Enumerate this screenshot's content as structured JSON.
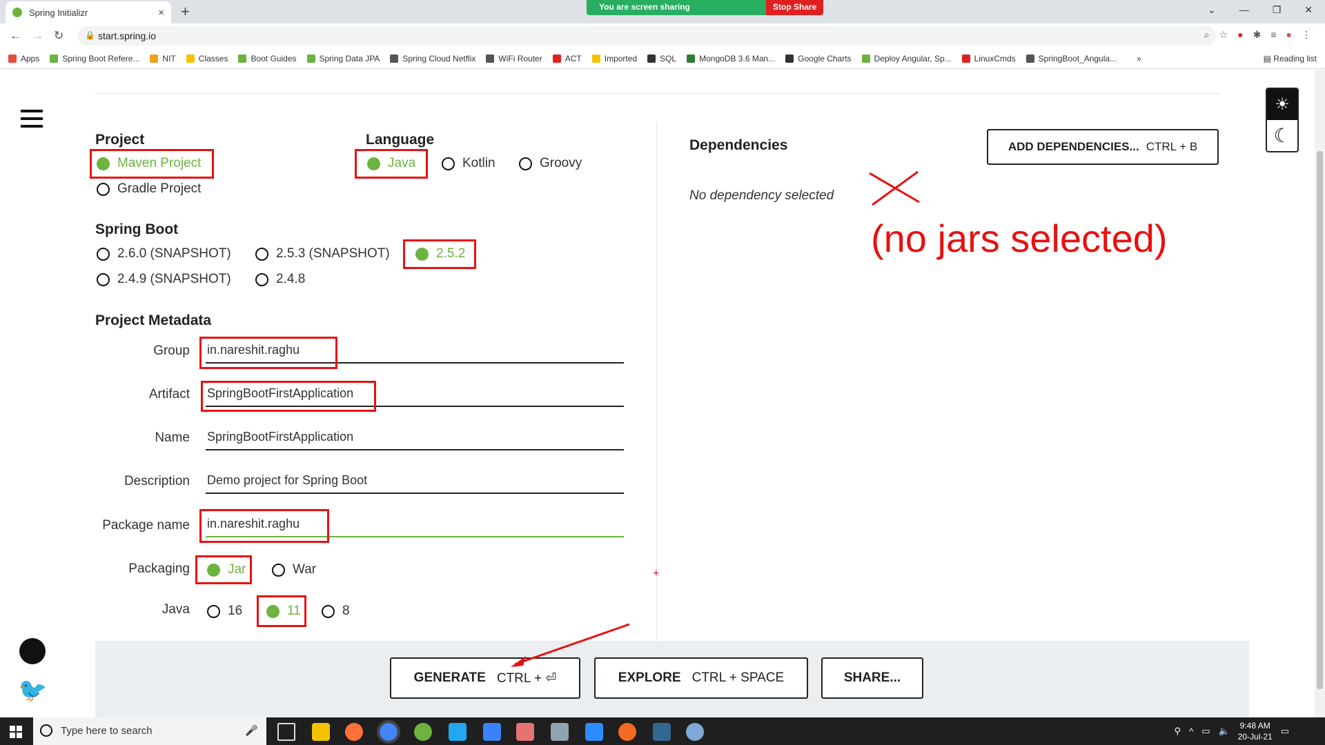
{
  "browser": {
    "tab_title": "Spring Initializr",
    "tab_close": "×",
    "new_tab": "+",
    "url": "start.spring.io",
    "screen_share": {
      "status": "You are screen sharing",
      "stop_label": "Stop Share"
    },
    "bookmarks": [
      {
        "label": "Apps",
        "color": "#e84a3c"
      },
      {
        "label": "Spring Boot Refere...",
        "color": "#6db33f"
      },
      {
        "label": "NIT",
        "color": "#f0a020"
      },
      {
        "label": "Classes",
        "color": "#f3c300"
      },
      {
        "label": "Boot Guides",
        "color": "#6db33f"
      },
      {
        "label": "Spring Data JPA",
        "color": "#6db33f"
      },
      {
        "label": "Spring Cloud Netflix",
        "color": "#555555"
      },
      {
        "label": "WiFi Router",
        "color": "#555555"
      },
      {
        "label": "ACT",
        "color": "#e02020"
      },
      {
        "label": "Imported",
        "color": "#f3c300"
      },
      {
        "label": "SQL",
        "color": "#333333"
      },
      {
        "label": "MongoDB 3.6 Man...",
        "color": "#2e7d32"
      },
      {
        "label": "Google Charts",
        "color": "#333333"
      },
      {
        "label": "Deploy Angular, Sp...",
        "color": "#6db33f"
      },
      {
        "label": "LinuxCmds",
        "color": "#e02020"
      },
      {
        "label": "SpringBoot_Angula...",
        "color": "#555555"
      }
    ],
    "bookmarks_more": "»",
    "reading_list": "Reading list"
  },
  "project": {
    "title": "Project",
    "options": [
      "Maven Project",
      "Gradle Project"
    ],
    "selected": "Maven Project"
  },
  "language": {
    "title": "Language",
    "options": [
      "Java",
      "Kotlin",
      "Groovy"
    ],
    "selected": "Java"
  },
  "spring_boot": {
    "title": "Spring Boot",
    "options": [
      "2.6.0 (SNAPSHOT)",
      "2.5.3 (SNAPSHOT)",
      "2.5.2",
      "2.4.9 (SNAPSHOT)",
      "2.4.8"
    ],
    "selected": "2.5.2"
  },
  "metadata": {
    "title": "Project Metadata",
    "group_label": "Group",
    "group_value": "in.nareshit.raghu",
    "artifact_label": "Artifact",
    "artifact_value": "SpringBootFirstApplication",
    "name_label": "Name",
    "name_value": "SpringBootFirstApplication",
    "description_label": "Description",
    "description_value": "Demo project for Spring Boot",
    "package_label": "Package name",
    "package_value": "in.nareshit.raghu",
    "packaging_label": "Packaging",
    "packaging_options": [
      "Jar",
      "War"
    ],
    "packaging_selected": "Jar",
    "java_label": "Java",
    "java_options": [
      "16",
      "11",
      "8"
    ],
    "java_selected": "11"
  },
  "dependencies": {
    "title": "Dependencies",
    "add_button_label": "ADD DEPENDENCIES...",
    "add_button_shortcut": "CTRL + B",
    "empty_text": "No dependency selected"
  },
  "annotation": {
    "text": "(no jars selected)",
    "color": "#e81010"
  },
  "actions": {
    "generate_label": "GENERATE",
    "generate_shortcut": "CTRL + ⏎",
    "explore_label": "EXPLORE",
    "explore_shortcut": "CTRL + SPACE",
    "share_label": "SHARE..."
  },
  "taskbar": {
    "search_placeholder": "Type here to search",
    "time": "9:48 AM",
    "date": "20-Jul-21"
  },
  "colors": {
    "accent": "#6db33f",
    "annotation": "#e81010"
  }
}
